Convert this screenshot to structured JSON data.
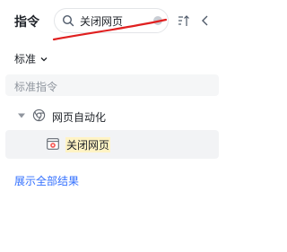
{
  "header": {
    "title": "指令",
    "search": {
      "value": "关闭网页",
      "placeholder": ""
    },
    "icons": [
      "search-icon",
      "sort-icon",
      "collapse-left-icon"
    ]
  },
  "filter": {
    "selected": "标准"
  },
  "section": {
    "title": "标准指令"
  },
  "tree": {
    "group": {
      "label": "网页自动化",
      "icon": "chrome-icon"
    },
    "items": [
      {
        "label": "关闭网页",
        "icon": "close-webpage-icon"
      }
    ]
  },
  "footer": {
    "show_all": "展示全部结果"
  },
  "colors": {
    "link": "#3370ff",
    "highlight": "#fff3c4",
    "annotation": "#e02020"
  }
}
